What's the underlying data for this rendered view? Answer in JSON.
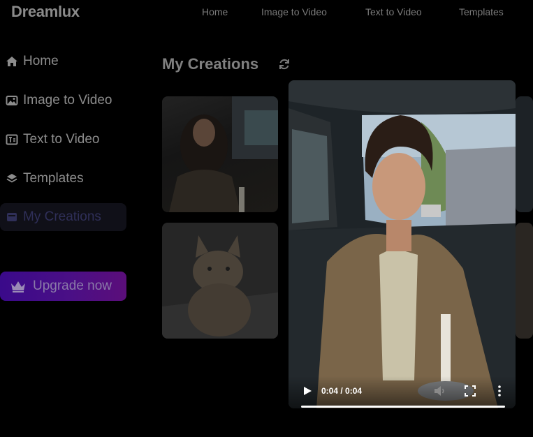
{
  "app": {
    "logo": "Dreamlux"
  },
  "topnav": [
    {
      "label": "Home"
    },
    {
      "label": "Image to Video"
    },
    {
      "label": "Text to Video"
    },
    {
      "label": "Templates"
    }
  ],
  "sidebar": {
    "items": [
      {
        "label": "Home",
        "icon": "home-icon"
      },
      {
        "label": "Image to Video",
        "icon": "image-icon"
      },
      {
        "label": "Text to Video",
        "icon": "text-video-icon"
      },
      {
        "label": "Templates",
        "icon": "layers-icon"
      },
      {
        "label": "My Creations",
        "icon": "folder-icon",
        "active": true
      }
    ],
    "upgrade_label": "Upgrade now"
  },
  "main": {
    "title": "My Creations"
  },
  "player": {
    "time": "0:04 / 0:04",
    "progress": 1.0
  },
  "colors": {
    "accent_start": "#3a0a8a",
    "accent_end": "#5b0e7a",
    "background": "#000000"
  }
}
